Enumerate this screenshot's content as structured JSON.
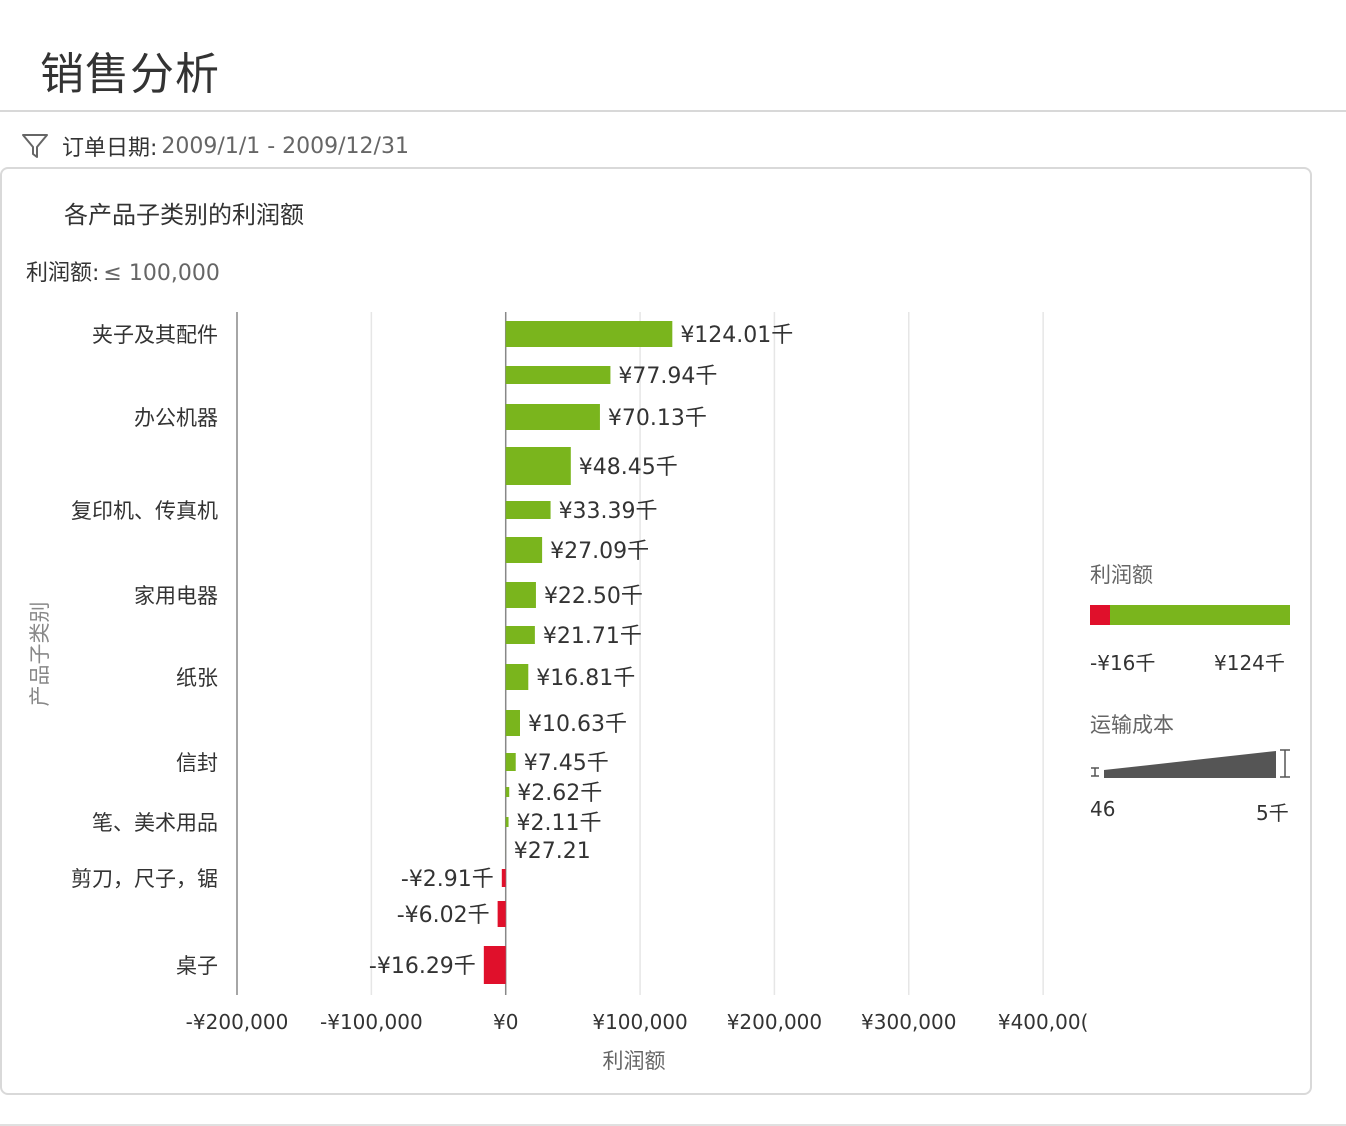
{
  "page": {
    "title": "销售分析"
  },
  "filter": {
    "label": "订单日期:",
    "value": "2009/1/1 - 2009/12/31",
    "icon": "funnel-icon"
  },
  "chart_card": {
    "title": "各产品子类别的利润额",
    "filter_label": "利润额:",
    "filter_value": "≤ 100,000"
  },
  "legend": {
    "color_title": "利润额",
    "color_min": "-¥16千",
    "color_max": "¥124千",
    "size_title": "运输成本",
    "size_min": "46",
    "size_max": "5千"
  },
  "colors": {
    "positive": "#7ab51d",
    "negative": "#e0102b",
    "grid": "#e6e6e6",
    "axis": "#888888",
    "size_legend": "#555555"
  },
  "chart_data": {
    "type": "bar",
    "orientation": "horizontal",
    "title": "各产品子类别的利润额",
    "xlabel": "利润额",
    "ylabel": "产品子类别",
    "xlim": [
      -200000,
      420000
    ],
    "x_ticks": [
      -200000,
      -100000,
      0,
      100000,
      200000,
      300000,
      400000
    ],
    "x_tick_labels": [
      "-¥200,000",
      "-¥100,000",
      "¥0",
      "¥100,000",
      "¥200,000",
      "¥300,000",
      "¥400,00("
    ],
    "grid": true,
    "legend_position": "right",
    "bars": [
      {
        "value": 124010,
        "label": "¥124.01千",
        "category": "夹子及其配件",
        "thickness": "medium"
      },
      {
        "value": 77940,
        "label": "¥77.94千",
        "category": "",
        "thickness": "small"
      },
      {
        "value": 70130,
        "label": "¥70.13千",
        "category": "办公机器",
        "thickness": "medium"
      },
      {
        "value": 48450,
        "label": "¥48.45千",
        "category": "",
        "thickness": "large"
      },
      {
        "value": 33390,
        "label": "¥33.39千",
        "category": "复印机、传真机",
        "thickness": "small"
      },
      {
        "value": 27090,
        "label": "¥27.09千",
        "category": "",
        "thickness": "medium"
      },
      {
        "value": 22500,
        "label": "¥22.50千",
        "category": "家用电器",
        "thickness": "medium"
      },
      {
        "value": 21710,
        "label": "¥21.71千",
        "category": "",
        "thickness": "small"
      },
      {
        "value": 16810,
        "label": "¥16.81千",
        "category": "纸张",
        "thickness": "medium"
      },
      {
        "value": 10630,
        "label": "¥10.63千",
        "category": "",
        "thickness": "medium"
      },
      {
        "value": 7450,
        "label": "¥7.45千",
        "category": "信封",
        "thickness": "small"
      },
      {
        "value": 2620,
        "label": "¥2.62千",
        "category": "",
        "thickness": "tiny"
      },
      {
        "value": 2110,
        "label": "¥2.11千",
        "category": "笔、美术用品",
        "thickness": "tiny"
      },
      {
        "value": 27.21,
        "label": "¥27.21",
        "category": "",
        "thickness": "tiny"
      },
      {
        "value": -2910,
        "label": "-¥2.91千",
        "category": "剪刀，尺子，锯",
        "thickness": "small"
      },
      {
        "value": -6020,
        "label": "-¥6.02千",
        "category": "",
        "thickness": "medium"
      },
      {
        "value": -16290,
        "label": "-¥16.29千",
        "category": "桌子",
        "thickness": "large"
      }
    ]
  }
}
